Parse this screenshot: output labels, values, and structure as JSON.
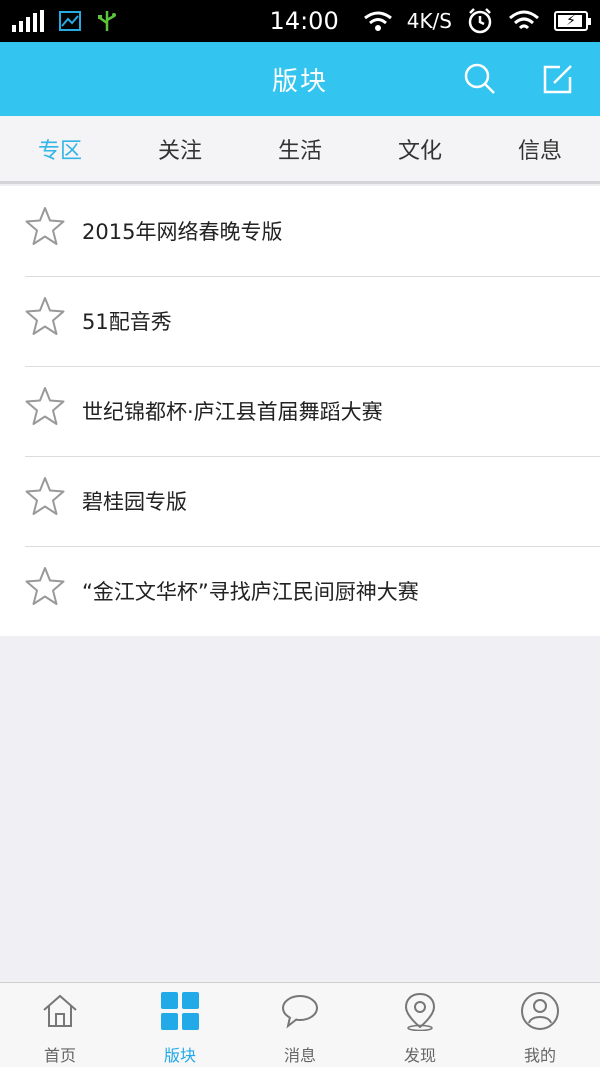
{
  "status_bar": {
    "time": "14:00",
    "network_speed": "4K/S"
  },
  "header": {
    "title": "版块"
  },
  "tabs": [
    {
      "label": "专区",
      "active": true
    },
    {
      "label": "关注",
      "active": false
    },
    {
      "label": "生活",
      "active": false
    },
    {
      "label": "文化",
      "active": false
    },
    {
      "label": "信息",
      "active": false
    }
  ],
  "forums": [
    {
      "name": "2015年网络春晚专版"
    },
    {
      "name": "51配音秀"
    },
    {
      "name": "世纪锦都杯·庐江县首届舞蹈大赛"
    },
    {
      "name": "碧桂园专版"
    },
    {
      "name": "“金江文华杯”寻找庐江民间厨神大赛"
    }
  ],
  "bottom_nav": [
    {
      "label": "首页",
      "icon": "home-icon",
      "active": false
    },
    {
      "label": "版块",
      "icon": "grid-icon",
      "active": true
    },
    {
      "label": "消息",
      "icon": "chat-bubble-icon",
      "active": false
    },
    {
      "label": "发现",
      "icon": "location-pin-icon",
      "active": false
    },
    {
      "label": "我的",
      "icon": "user-icon",
      "active": false
    }
  ],
  "colors": {
    "header_bg": "#33c4f0",
    "active_tab": "#33b5e5",
    "active_nav": "#22a9e8"
  }
}
